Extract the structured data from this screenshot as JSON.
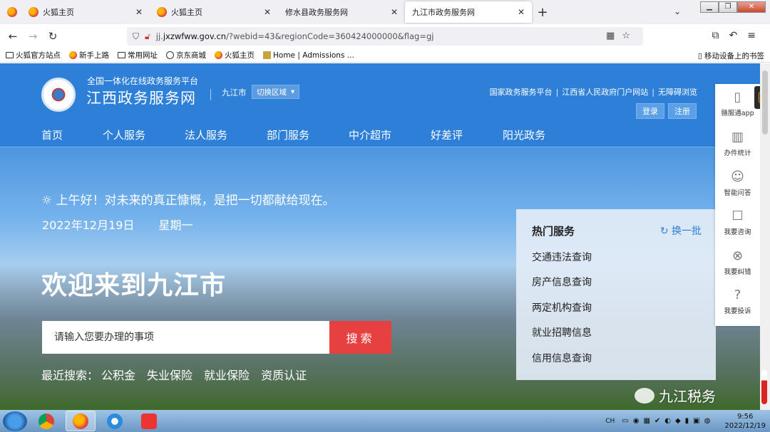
{
  "browser": {
    "tabs": [
      {
        "label": "",
        "active": false
      },
      {
        "label": "火狐主页",
        "active": false
      },
      {
        "label": "火狐主页",
        "active": false
      },
      {
        "label": "修水县政务服务网",
        "active": false
      },
      {
        "label": "九江市政务服务网",
        "active": true
      }
    ],
    "new_tab": "+",
    "tab_list": "⌄",
    "url_prefix": "jj.",
    "url_domain": "jxzwfww.gov.cn",
    "url_rest": "/?webid=43&regionCode=360424000000&flag=gj",
    "bookmarks": [
      {
        "label": "火狐官方站点",
        "icon": "folder-icon"
      },
      {
        "label": "新手上路",
        "icon": "firefox-icon"
      },
      {
        "label": "常用网址",
        "icon": "folder-icon"
      },
      {
        "label": "京东商城",
        "icon": "globe-icon"
      },
      {
        "label": "火狐主页",
        "icon": "firefox-icon"
      },
      {
        "label": "Home | Admissions ...",
        "icon": "home-icon"
      }
    ],
    "mobile_bookmarks": "移动设备上的书签"
  },
  "site": {
    "subtitle": "全国一体化在线政务服务平台",
    "title": "江西政务服务网",
    "city": "九江市",
    "switch_region": "切换区域",
    "top_links": [
      "国家政务服务平台",
      "江西省人民政府门户网站",
      "无障碍浏览"
    ],
    "login": "登录",
    "register": "注册",
    "nav": [
      "首页",
      "个人服务",
      "法人服务",
      "部门服务",
      "中介超市",
      "好差评",
      "阳光政务"
    ]
  },
  "hero": {
    "greeting": "上午好！对未来的真正慷慨，是把一切都献给现在。",
    "date": "2022年12月19日",
    "weekday": "星期一",
    "welcome": "欢迎来到九江市",
    "search_placeholder": "请输入您要办理的事项",
    "search_button": "搜索",
    "recent_label": "最近搜索：",
    "recent_items": [
      "公积金",
      "失业保险",
      "就业保险",
      "资质认证"
    ]
  },
  "hot_services": {
    "title": "热门服务",
    "refresh": "换一批",
    "items": [
      "交通违法查询",
      "房产信息查询",
      "两定机构查询",
      "就业招聘信息",
      "信用信息查询"
    ]
  },
  "float_panel": {
    "items": [
      {
        "label": "赣服通app",
        "icon": "app-phone-icon"
      },
      {
        "label": "办件统计",
        "icon": "bar-chart-icon"
      },
      {
        "label": "智能问答",
        "icon": "robot-icon"
      },
      {
        "label": "我要咨询",
        "icon": "chat-icon"
      },
      {
        "label": "我要纠错",
        "icon": "error-circle-icon"
      },
      {
        "label": "我要投诉",
        "icon": "complaint-icon"
      }
    ]
  },
  "watermark": "九江税务",
  "taskbar": {
    "lang": "CH",
    "time": "9:56",
    "date": "2022/12/19"
  },
  "colors": {
    "brand_blue": "#2d7fd8",
    "search_red": "#e74040",
    "link_blue": "#2f7fd6"
  }
}
